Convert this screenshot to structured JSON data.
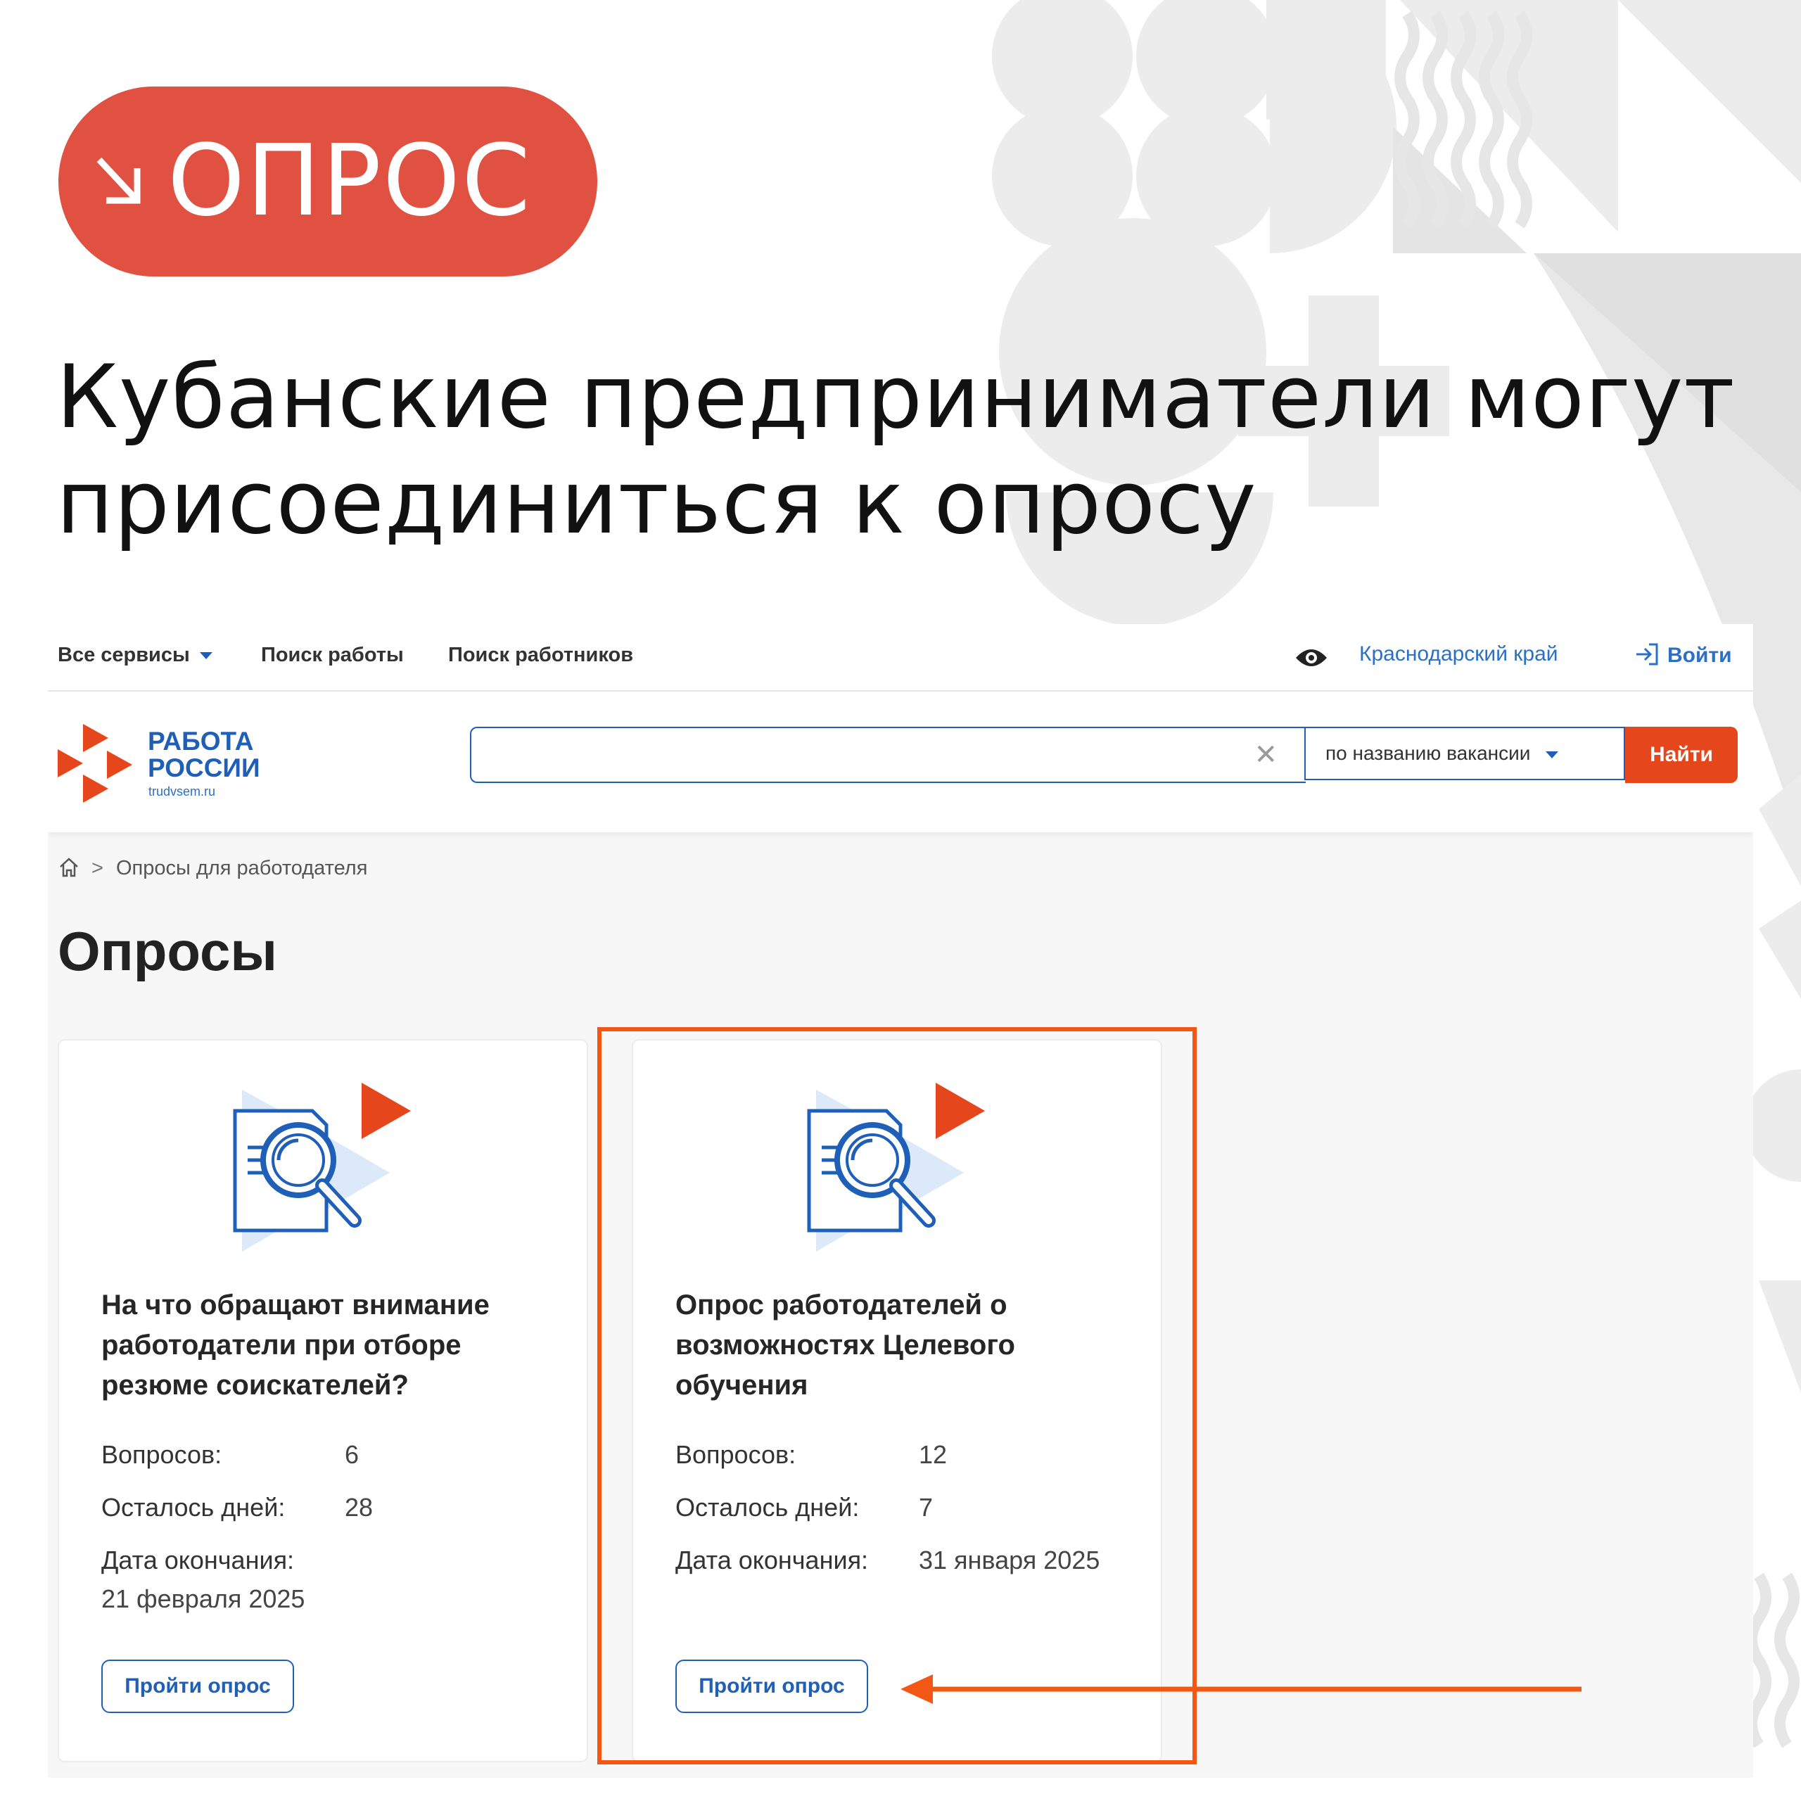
{
  "badge": {
    "label": "ОПРОС"
  },
  "headline": "Кубанские предприниматели могут присоединиться к опросу",
  "topnav": {
    "all_services": "Все сервисы",
    "job_search": "Поиск работы",
    "worker_search": "Поиск работников",
    "region": "Краснодарский край",
    "login": "Войти"
  },
  "logo": {
    "line1": "РАБОТА",
    "line2": "РОССИИ",
    "site": "trudvsem.ru"
  },
  "search": {
    "value": "",
    "mode": "по названию вакансии",
    "button": "Найти"
  },
  "breadcrumb": {
    "current": "Опросы для работодателя"
  },
  "page_title": "Опросы",
  "surveys": [
    {
      "title": "На что обращают внимание работодатели при отборе резюме соискателей?",
      "questions_label": "Вопросов:",
      "questions": "6",
      "days_label": "Осталось дней:",
      "days": "28",
      "end_label": "Дата окончания:",
      "end_date": "21 февраля 2025",
      "button": "Пройти опрос"
    },
    {
      "title": "Опрос работодателей о возможностях Целевого обучения",
      "questions_label": "Вопросов:",
      "questions": "12",
      "days_label": "Осталось дней:",
      "days": "7",
      "end_label": "Дата окончания:",
      "end_date": "31 января 2025",
      "button": "Пройти опрос"
    }
  ],
  "colors": {
    "badge": "#e05142",
    "brand_blue": "#1f5fb8",
    "accent_orange": "#e6461b",
    "highlight": "#f25716"
  }
}
